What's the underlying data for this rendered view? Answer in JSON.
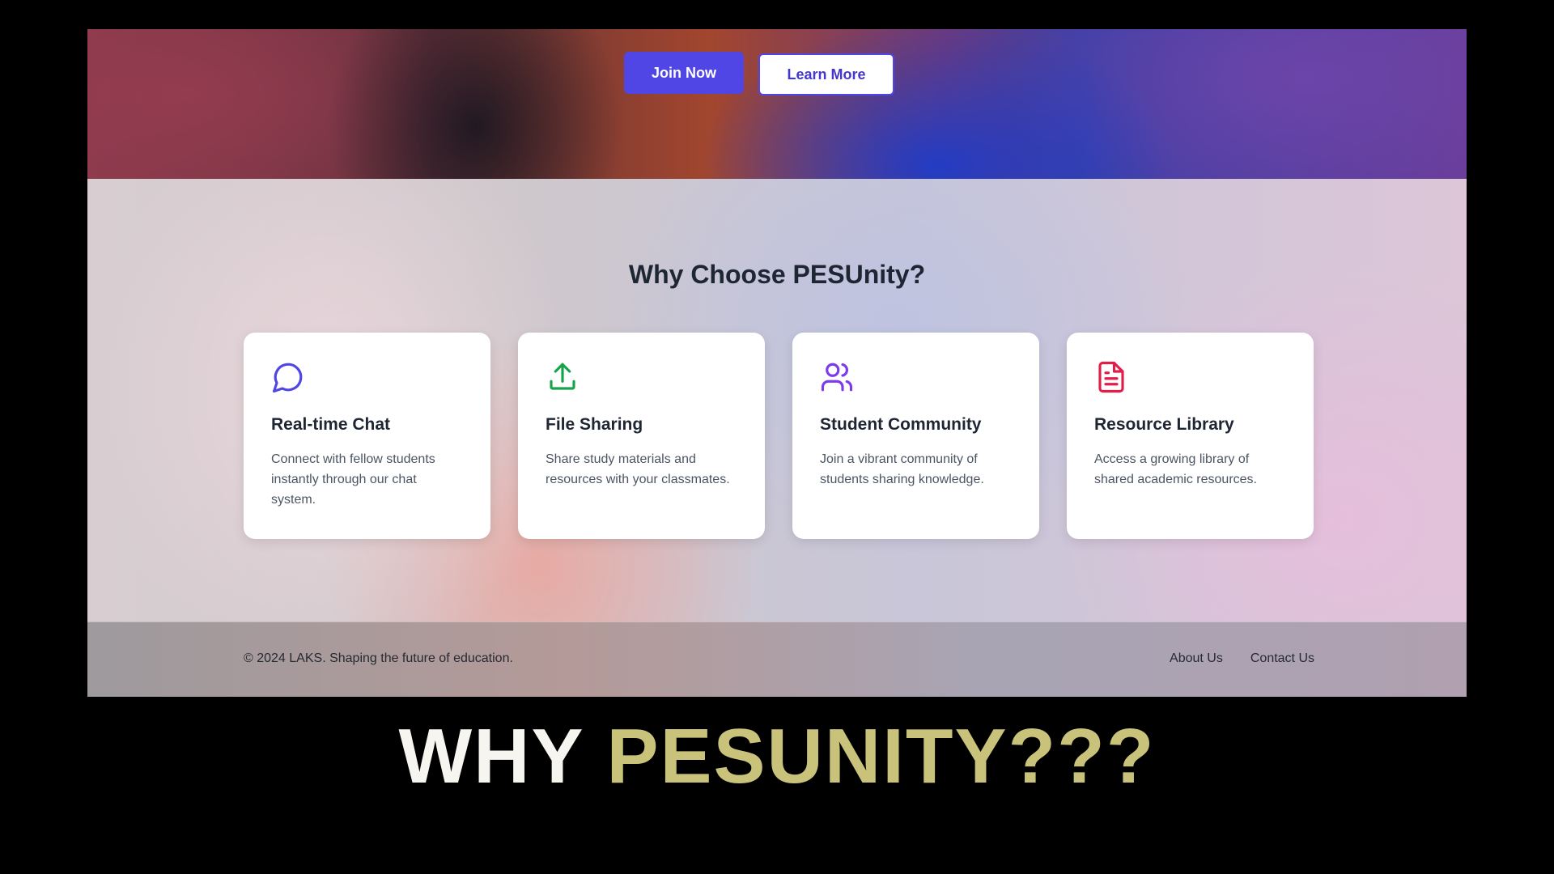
{
  "hero": {
    "join_label": "Join Now",
    "learn_label": "Learn More"
  },
  "features": {
    "title": "Why Choose PESUnity?",
    "cards": [
      {
        "icon": "chat-bubble-icon",
        "title": "Real-time Chat",
        "text": "Connect with fellow students instantly through our chat system."
      },
      {
        "icon": "upload-icon",
        "title": "File Sharing",
        "text": "Share study materials and resources with your classmates."
      },
      {
        "icon": "users-icon",
        "title": "Student Community",
        "text": "Join a vibrant community of students sharing knowledge."
      },
      {
        "icon": "document-icon",
        "title": "Resource Library",
        "text": "Access a growing library of shared academic resources."
      }
    ]
  },
  "footer": {
    "copyright": "© 2024 LAKS. Shaping the future of education.",
    "links": [
      "About Us",
      "Contact Us"
    ]
  },
  "caption": {
    "word1": "WHY",
    "word2": "PESUNITY???"
  },
  "colors": {
    "primary": "#4f46e5",
    "chat_icon": "#4f46e5",
    "upload_icon": "#16a34a",
    "users_icon": "#7c3aed",
    "document_icon": "#e11d48",
    "caption_white": "#f7f5ef",
    "caption_gold": "#c9c27a"
  }
}
